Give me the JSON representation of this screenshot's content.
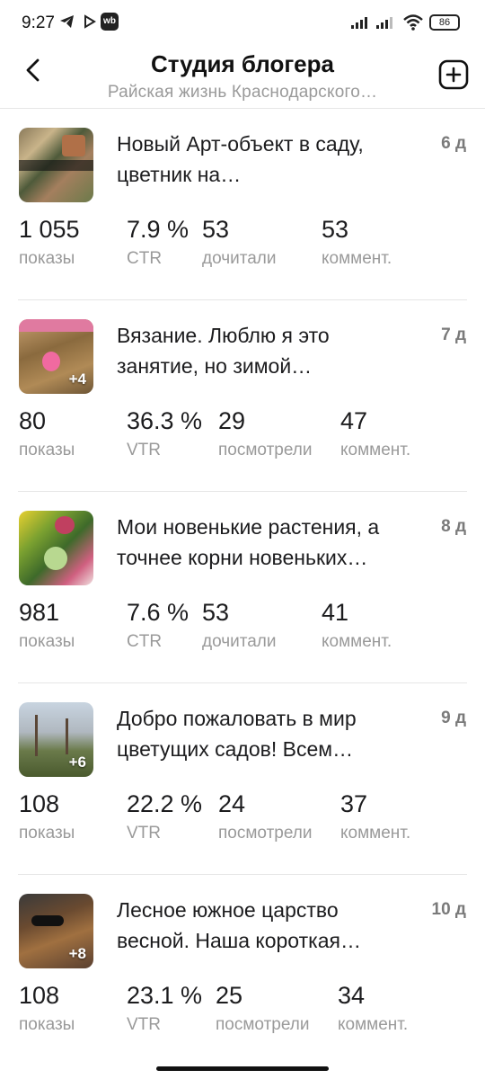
{
  "status_bar": {
    "time": "9:27",
    "app_icons": [
      "telegram-icon",
      "play-icon",
      "wb-icon"
    ],
    "wb_label": "wb",
    "battery": "86"
  },
  "header": {
    "title": "Студия блогера",
    "subtitle": "Райская жизнь Краснодарского…"
  },
  "posts": [
    {
      "title_line1": "Новый Арт-объект в саду,",
      "title_line2": "цветник на…",
      "age": "6 д",
      "thumb_extra": "",
      "stats": [
        {
          "value": "1 055",
          "label": "показы"
        },
        {
          "value": "7.9 %",
          "label": "CTR"
        },
        {
          "value": "53",
          "label": "дочитали"
        },
        {
          "value": "53",
          "label": "коммент."
        }
      ]
    },
    {
      "title_line1": "Вязание. Люблю я это",
      "title_line2": "занятие, но зимой…",
      "age": "7 д",
      "thumb_extra": "+4",
      "stats": [
        {
          "value": "80",
          "label": "показы"
        },
        {
          "value": "36.3 %",
          "label": "VTR"
        },
        {
          "value": "29",
          "label": "посмотрели"
        },
        {
          "value": "47",
          "label": "коммент."
        }
      ]
    },
    {
      "title_line1": "Мои новенькие растения, а",
      "title_line2": "точнее корни новеньких…",
      "age": "8 д",
      "thumb_extra": "",
      "stats": [
        {
          "value": "981",
          "label": "показы"
        },
        {
          "value": "7.6 %",
          "label": "CTR"
        },
        {
          "value": "53",
          "label": "дочитали"
        },
        {
          "value": "41",
          "label": "коммент."
        }
      ]
    },
    {
      "title_line1": "Добро пожаловать в мир",
      "title_line2": "цветущих садов! Всем…",
      "age": "9 д",
      "thumb_extra": "+6",
      "stats": [
        {
          "value": "108",
          "label": "показы"
        },
        {
          "value": "22.2 %",
          "label": "VTR"
        },
        {
          "value": "24",
          "label": "посмотрели"
        },
        {
          "value": "37",
          "label": "коммент."
        }
      ]
    },
    {
      "title_line1": "Лесное южное царство",
      "title_line2": "весной. Наша короткая…",
      "age": "10 д",
      "thumb_extra": "+8",
      "stats": [
        {
          "value": "108",
          "label": "показы"
        },
        {
          "value": "23.1 %",
          "label": "VTR"
        },
        {
          "value": "25",
          "label": "посмотрели"
        },
        {
          "value": "34",
          "label": "коммент."
        }
      ]
    }
  ]
}
